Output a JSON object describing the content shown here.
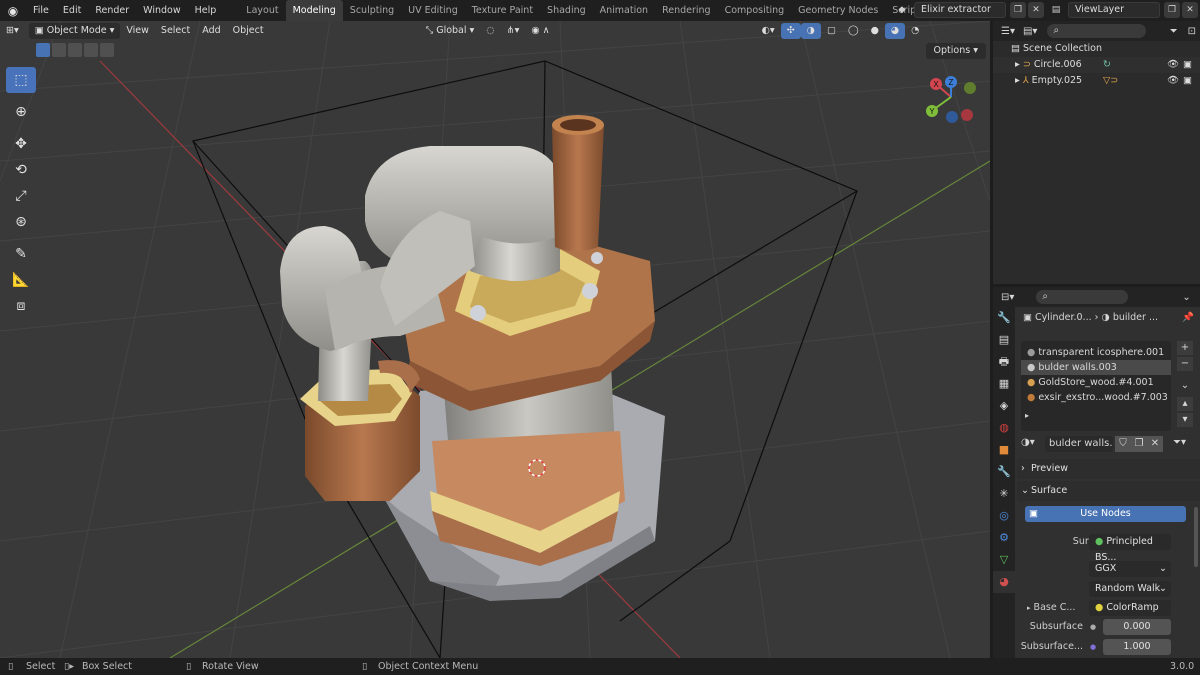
{
  "menu": {
    "items": [
      "File",
      "Edit",
      "Render",
      "Window",
      "Help"
    ]
  },
  "workspaces": [
    "Layout",
    "Modeling",
    "Sculpting",
    "UV Editing",
    "Texture Paint",
    "Shading",
    "Animation",
    "Rendering",
    "Compositing",
    "Geometry Nodes",
    "Scripting"
  ],
  "active_workspace": "Modeling",
  "scene": {
    "name": "Elixir extractor",
    "view_layer": "ViewLayer"
  },
  "viewport": {
    "mode": "Object Mode",
    "menus": [
      "View",
      "Select",
      "Add",
      "Object"
    ],
    "orientation": "Global",
    "options_label": "Options",
    "gizmo_axes": {
      "x": "X",
      "y": "Y",
      "z": "Z"
    }
  },
  "outliner": {
    "root": "Scene Collection",
    "items": [
      {
        "name": "Circle.006"
      },
      {
        "name": "Empty.025"
      }
    ]
  },
  "properties": {
    "breadcrumb_object": "Cylinder.0...",
    "breadcrumb_material": "builder ...",
    "materials": [
      {
        "name": "transparent icosphere.001"
      },
      {
        "name": "bulder walls.003"
      },
      {
        "name": "GoldStore_wood.#4.001"
      },
      {
        "name": "exsir_exstro...wood.#7.003"
      }
    ],
    "active_material_field": "bulder walls...",
    "panels": {
      "preview": "Preview",
      "surface": "Surface"
    },
    "use_nodes_label": "Use Nodes",
    "surface_label": "Surface",
    "surface_value": "Principled BS...",
    "distribution": "GGX",
    "subsurface_method": "Random Walk",
    "base_color_label": "Base C...",
    "base_color_value": "ColorRamp",
    "subsurface_label": "Subsurface",
    "subsurface_value": "0.000",
    "subsurface_radius_label": "Subsurface...",
    "subsurface_radius_value": "1.000"
  },
  "statusbar": {
    "select": "Select",
    "box_select": "Box Select",
    "rotate_view": "Rotate View",
    "context_menu": "Object Context Menu",
    "version": "3.0.0"
  },
  "colors": {
    "accent": "#4772b3",
    "x_axis": "#d34650",
    "y_axis": "#7fbf3a",
    "z_axis": "#3d7fd8"
  }
}
